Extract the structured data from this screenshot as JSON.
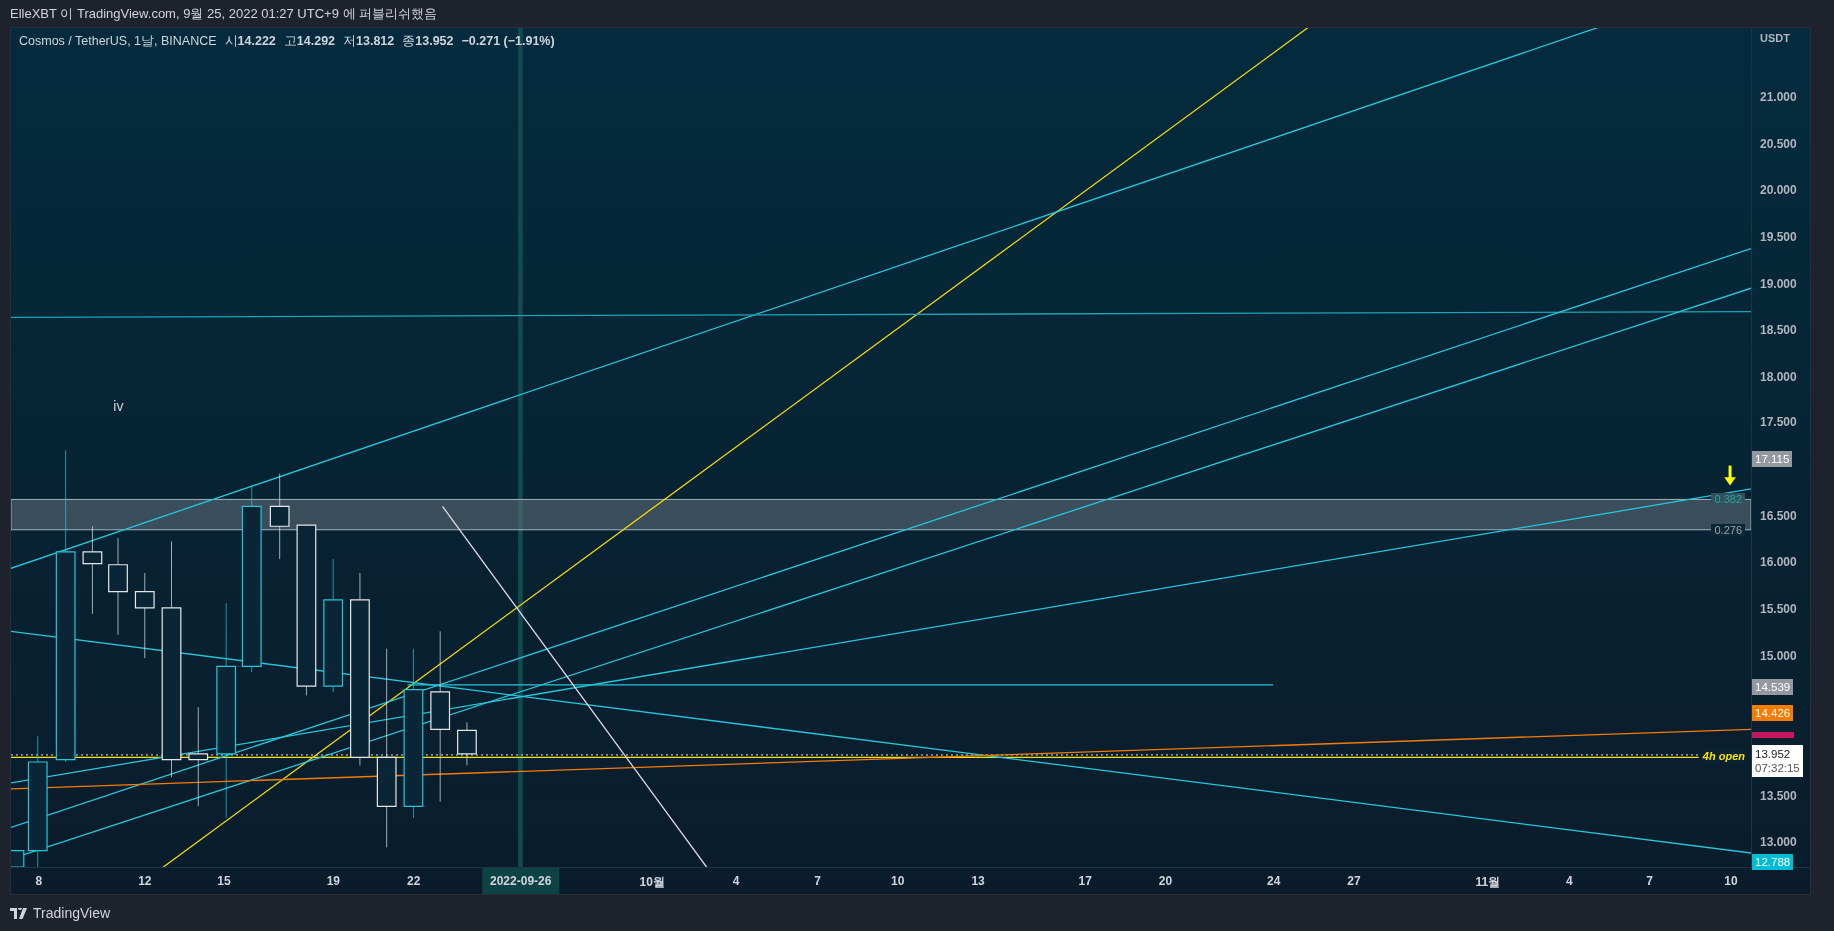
{
  "header": {
    "text": "ElleXBT 이 TradingView.com, 9월 25, 2022 01:27 UTC+9 에 퍼블리쉬했음"
  },
  "legend": {
    "symbol": "Cosmos / TetherUS, 1날, BINANCE",
    "ohlc": [
      {
        "label": "시",
        "value": "14.222"
      },
      {
        "label": "고",
        "value": "14.292"
      },
      {
        "label": "저",
        "value": "13.812"
      },
      {
        "label": "종",
        "value": "13.952"
      }
    ],
    "change": "−0.271 (−1.91%)"
  },
  "annotations": [
    {
      "kind": "wave",
      "text": "iv"
    },
    {
      "kind": "fib-upper",
      "text": "0.382"
    },
    {
      "kind": "fib-lower",
      "text": "0.276"
    },
    {
      "kind": "line-label",
      "text": "4h open"
    }
  ],
  "price_axis": {
    "unit": "USDT",
    "ticks": [
      "21.000",
      "20.500",
      "20.000",
      "19.500",
      "19.000",
      "18.500",
      "18.000",
      "17.500",
      "16.500",
      "16.000",
      "15.500",
      "15.000",
      "13.500",
      "13.000"
    ],
    "badges": [
      {
        "value": "17.115",
        "color": "#9598a1"
      },
      {
        "value": "14.539",
        "color": "#9598a1"
      },
      {
        "value": "14.426",
        "color": "#f57c00"
      },
      {
        "color": "#c2185b"
      },
      {
        "value": "13.952",
        "countdown": "07:32:15",
        "color": "#ffffff"
      },
      {
        "value": "12.788",
        "color": "#00bcd4"
      }
    ]
  },
  "time_axis": {
    "labels": [
      "8",
      "12",
      "15",
      "19",
      "22",
      "10월",
      "4",
      "7",
      "10",
      "13",
      "17",
      "20",
      "24",
      "27",
      "11월",
      "4",
      "7",
      "10"
    ],
    "cursor": "2022-09-26"
  },
  "footer": {
    "brand": "TradingView"
  }
}
